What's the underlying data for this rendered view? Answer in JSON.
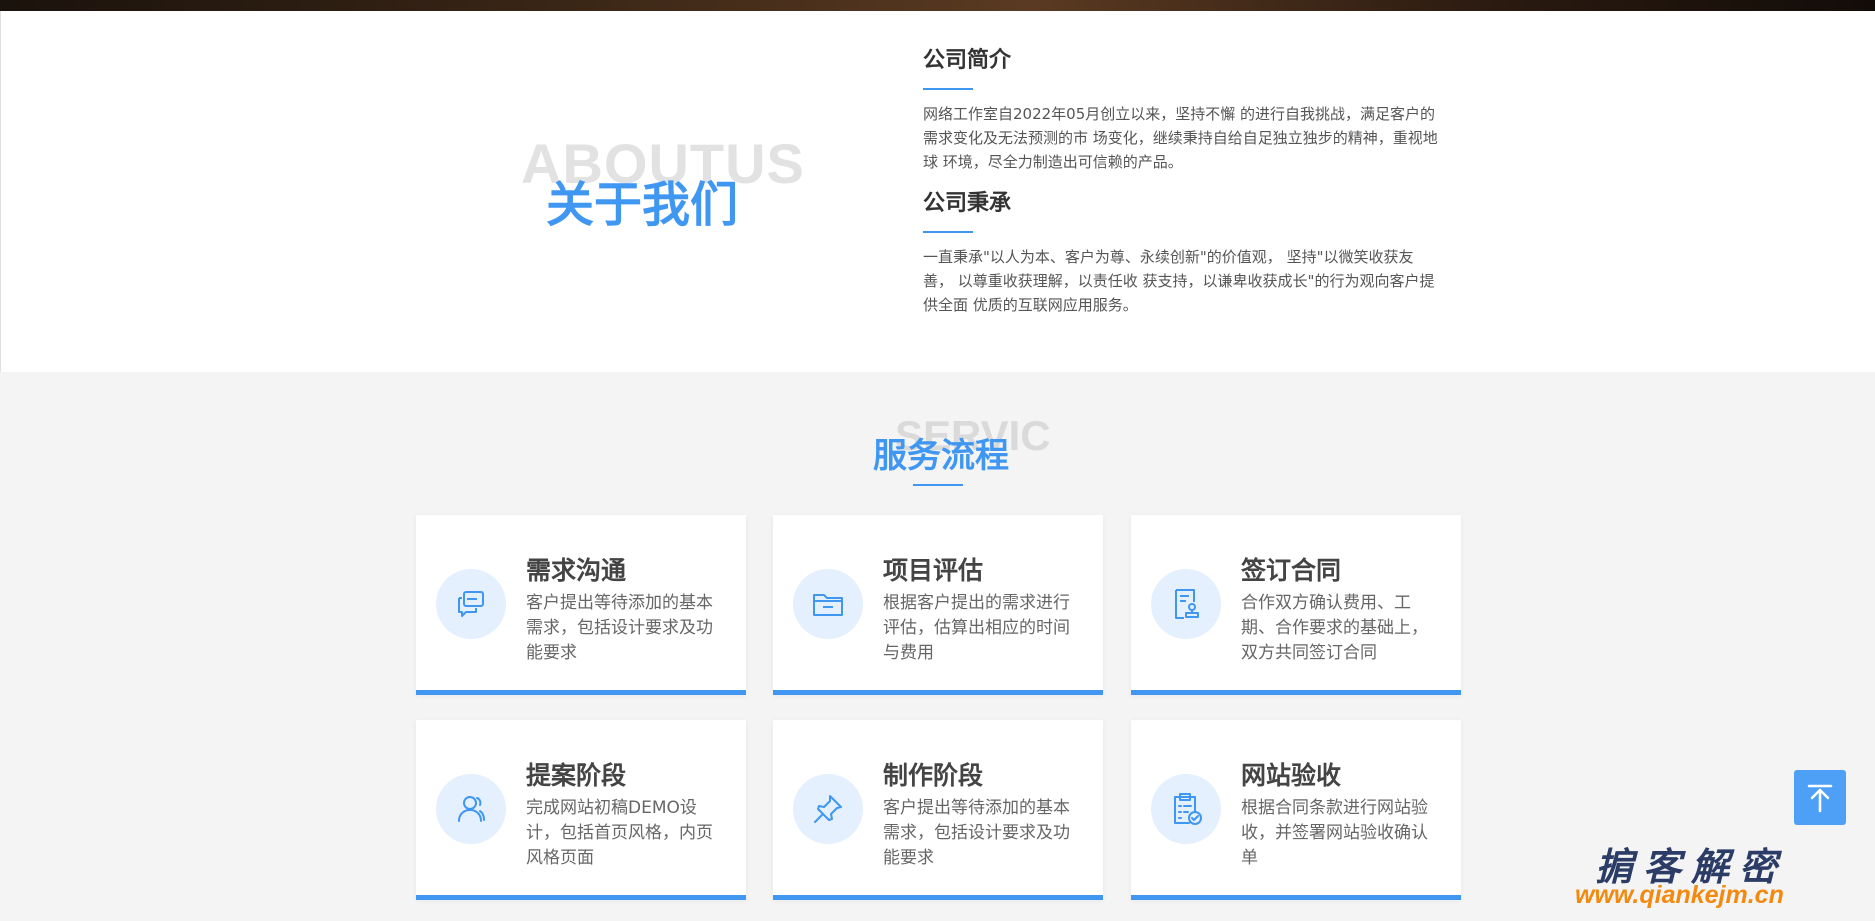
{
  "about": {
    "bg_word": "ABOUTUS",
    "title": "关于我们",
    "blocks": [
      {
        "title": "公司简介",
        "text": "网络工作室自2022年05月创立以来，坚持不懈 的进行自我挑战，满足客户的需求变化及无法预测的市 场变化，继续秉持自给自足独立独步的精神，重视地球 环境，尽全力制造出可信赖的产品。"
      },
      {
        "title": "公司秉承",
        "text": "一直秉承\"以人为本、客户为尊、永续创新\"的价值观， 坚持\"以微笑收获友善， 以尊重收获理解，以责任收 获支持，以谦卑收获成长\"的行为观向客户提供全面 优质的互联网应用服务。"
      }
    ]
  },
  "service": {
    "bg_word": "SERVIC",
    "title": "服务流程",
    "accent_color": "#3f97f2",
    "cards": [
      {
        "icon": "chat-icon",
        "title": "需求沟通",
        "desc": "客户提出等待添加的基本需求，包括设计要求及功能要求"
      },
      {
        "icon": "folder-icon",
        "title": "项目评估",
        "desc": "根据客户提出的需求进行评估，估算出相应的时间与费用"
      },
      {
        "icon": "contract-icon",
        "title": "签订合同",
        "desc": "合作双方确认费用、工期、合作要求的基础上，双方共同签订合同"
      },
      {
        "icon": "users-icon",
        "title": "提案阶段",
        "desc": "完成网站初稿DEMO设计，包括首页风格，内页风格页面"
      },
      {
        "icon": "pin-icon",
        "title": "制作阶段",
        "desc": "客户提出等待添加的基本需求，包括设计要求及功能要求"
      },
      {
        "icon": "checklist-icon",
        "title": "网站验收",
        "desc": "根据合同条款进行网站验收，并签署网站验收确认单"
      }
    ]
  },
  "back_to_top": {
    "icon": "arrow-up-icon"
  },
  "watermark": {
    "text": "掮客解密",
    "url": "www.qiankejm.cn"
  }
}
